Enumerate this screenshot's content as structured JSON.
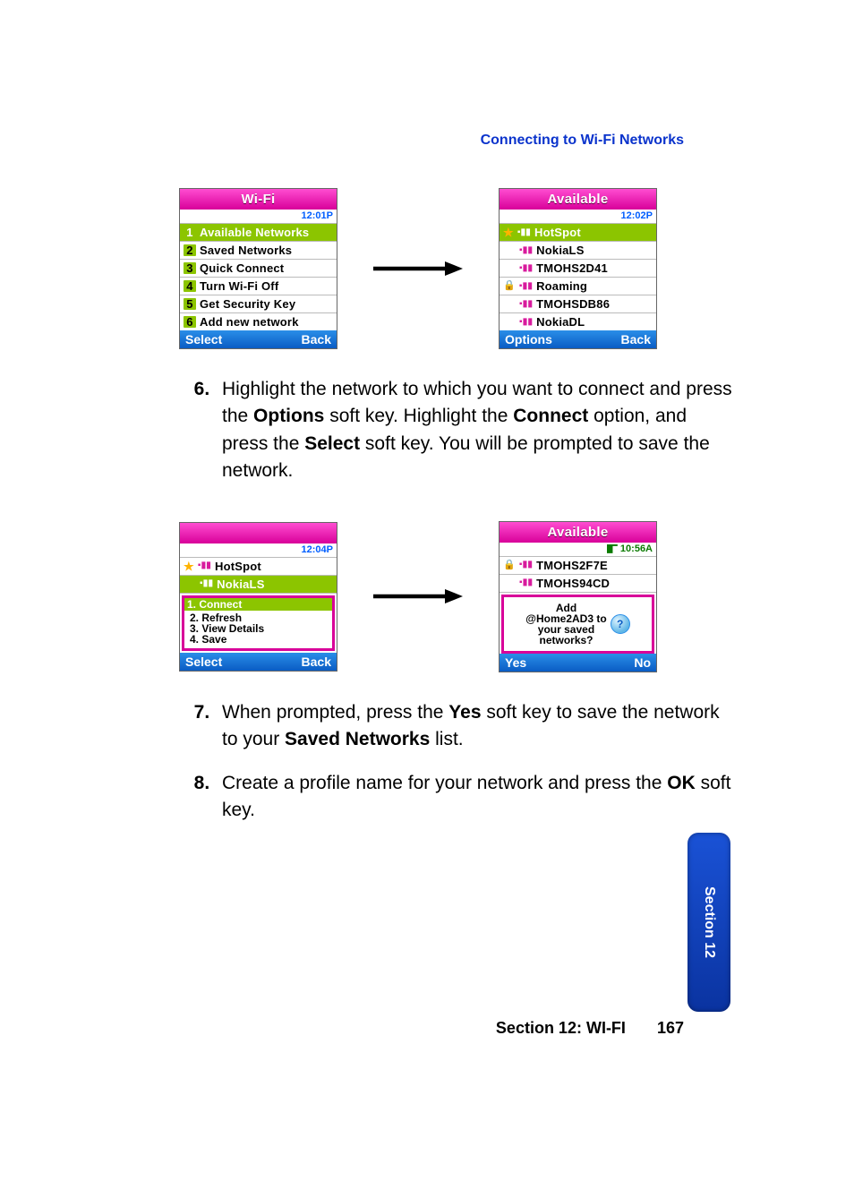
{
  "header": {
    "title": "Connecting to Wi-Fi Networks"
  },
  "screens": {
    "wifi_menu": {
      "title": "Wi-Fi",
      "time": "12:01P",
      "items": [
        {
          "n": "1",
          "label": "Available Networks",
          "selected": true
        },
        {
          "n": "2",
          "label": "Saved Networks"
        },
        {
          "n": "3",
          "label": "Quick Connect"
        },
        {
          "n": "4",
          "label": "Turn Wi-Fi Off"
        },
        {
          "n": "5",
          "label": "Get Security Key"
        },
        {
          "n": "6",
          "label": "Add new network"
        }
      ],
      "left": "Select",
      "right": "Back"
    },
    "available": {
      "title": "Available",
      "time": "12:02P",
      "items": [
        {
          "label": "HotSpot",
          "star": true,
          "selected": true
        },
        {
          "label": "NokiaLS"
        },
        {
          "label": "TMOHS2D41"
        },
        {
          "label": "Roaming",
          "lock": true
        },
        {
          "label": "TMOHSDB86"
        },
        {
          "label": "NokiaDL"
        }
      ],
      "left": "Options",
      "right": "Back"
    },
    "options_popup": {
      "title": "",
      "time": "12:04P",
      "list_top": [
        {
          "label": "HotSpot",
          "star": true
        },
        {
          "label": "NokiaLS",
          "selected": true
        }
      ],
      "options": [
        "1. Connect",
        "2. Refresh",
        "3. View Details",
        "4. Save"
      ],
      "left": "Select",
      "right": "Back"
    },
    "confirm": {
      "title": "Available",
      "time": "10:56A",
      "items": [
        {
          "label": "TMOHS2F7E",
          "lock": true
        },
        {
          "label": "TMOHS94CD"
        }
      ],
      "dialog": {
        "line1": "Add",
        "line2": "@Home2AD3 to",
        "line3": "your saved",
        "line4": "networks?"
      },
      "left": "Yes",
      "right": "No"
    }
  },
  "instructions": {
    "s6": {
      "n": "6.",
      "t1": "Highlight the network to which you want to connect and press the ",
      "b1": "Options",
      "t2": " soft key. Highlight the ",
      "b2": "Connect",
      "t3": " option, and press the ",
      "b3": "Select",
      "t4": " soft key. You will be prompted to save the network."
    },
    "s7": {
      "n": "7.",
      "t1": "When prompted, press the ",
      "b1": "Yes",
      "t2": " soft key to save the network to your ",
      "b2": "Saved Networks",
      "t3": " list."
    },
    "s8": {
      "n": "8.",
      "t1": "Create a profile name for your network and press the ",
      "b1": "OK",
      "t2": " soft key."
    }
  },
  "tab": {
    "label": "Section 12"
  },
  "footer": {
    "section": "Section 12: WI-FI",
    "page": "167"
  }
}
